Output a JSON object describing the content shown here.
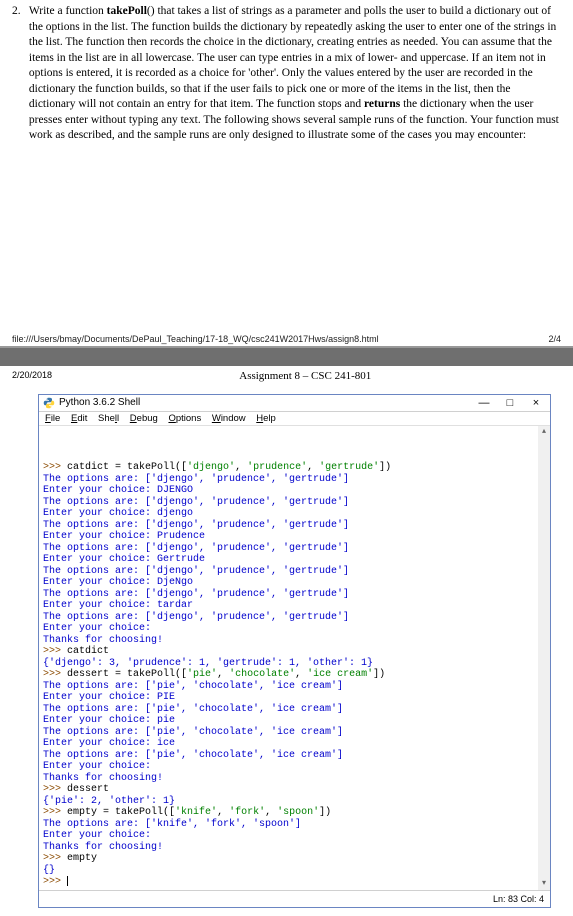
{
  "question": {
    "number": "2.",
    "func": "takePoll",
    "body_parts": [
      "Write a function ",
      "() that takes a list of strings as a parameter and polls the user to build a dictionary out of the options in the list. The function builds the dictionary by repeatedly asking the user to enter one of the strings in the list. The function then records the choice in the dictionary, creating entries as needed. You can assume that the items in the list are in all lowercase. The user can type entries in a mix of lower- and uppercase. If an item not in options is entered, it is recorded as a choice for 'other'. Only the values entered by the user are recorded in the dictionary the function builds, so that if the user fails to pick one or more of the items in the list, then the dictionary will not contain an entry for that item. The function stops and ",
      " the dictionary when the user presses enter without typing any text. The following shows several sample runs of the function. Your function must work as described, and the sample runs are only designed to illustrate some of the cases you may encounter:"
    ],
    "returns": "returns"
  },
  "footer": {
    "path": "file:///Users/bmay/Documents/DePaul_Teaching/17-18_WQ/csc241W2017Hws/assign8.html",
    "page": "2/4"
  },
  "page2": {
    "date": "2/20/2018",
    "title": "Assignment 8 – CSC 241-801"
  },
  "shell": {
    "title": "Python 3.6.2 Shell",
    "menus": [
      "File",
      "Edit",
      "Shell",
      "Debug",
      "Options",
      "Window",
      "Help"
    ],
    "status": "Ln: 83  Col: 4",
    "win_min": "—",
    "win_max": "□",
    "win_close": "×",
    "lines": [
      {
        "cls": "",
        "html": "<span class='prompt'>&gt;&gt;&gt;</span> catdict = takePoll([<span class='str'>'djengo'</span>, <span class='str'>'prudence'</span>, <span class='str'>'gertrude'</span>])"
      },
      {
        "cls": "out",
        "text": "The options are: ['djengo', 'prudence', 'gertrude']"
      },
      {
        "cls": "out",
        "text": "Enter your choice: DJENGO"
      },
      {
        "cls": "out",
        "text": "The options are: ['djengo', 'prudence', 'gertrude']"
      },
      {
        "cls": "out",
        "text": "Enter your choice: djengo"
      },
      {
        "cls": "out",
        "text": "The options are: ['djengo', 'prudence', 'gertrude']"
      },
      {
        "cls": "out",
        "text": "Enter your choice: Prudence"
      },
      {
        "cls": "out",
        "text": "The options are: ['djengo', 'prudence', 'gertrude']"
      },
      {
        "cls": "out",
        "text": "Enter your choice: Gertrude"
      },
      {
        "cls": "out",
        "text": "The options are: ['djengo', 'prudence', 'gertrude']"
      },
      {
        "cls": "out",
        "text": "Enter your choice: DjeNgo"
      },
      {
        "cls": "out",
        "text": "The options are: ['djengo', 'prudence', 'gertrude']"
      },
      {
        "cls": "out",
        "text": "Enter your choice: tardar"
      },
      {
        "cls": "out",
        "text": "The options are: ['djengo', 'prudence', 'gertrude']"
      },
      {
        "cls": "out",
        "text": "Enter your choice: "
      },
      {
        "cls": "out",
        "text": "Thanks for choosing!"
      },
      {
        "cls": "",
        "html": "<span class='prompt'>&gt;&gt;&gt;</span> catdict"
      },
      {
        "cls": "out",
        "text": "{'djengo': 3, 'prudence': 1, 'gertrude': 1, 'other': 1}"
      },
      {
        "cls": "",
        "html": "<span class='prompt'>&gt;&gt;&gt;</span> dessert = takePoll([<span class='str'>'pie'</span>, <span class='str'>'chocolate'</span>, <span class='str'>'ice cream'</span>])"
      },
      {
        "cls": "out",
        "text": "The options are: ['pie', 'chocolate', 'ice cream']"
      },
      {
        "cls": "out",
        "text": "Enter your choice: PIE"
      },
      {
        "cls": "out",
        "text": "The options are: ['pie', 'chocolate', 'ice cream']"
      },
      {
        "cls": "out",
        "text": "Enter your choice: pie"
      },
      {
        "cls": "out",
        "text": "The options are: ['pie', 'chocolate', 'ice cream']"
      },
      {
        "cls": "out",
        "text": "Enter your choice: ice"
      },
      {
        "cls": "out",
        "text": "The options are: ['pie', 'chocolate', 'ice cream']"
      },
      {
        "cls": "out",
        "text": "Enter your choice: "
      },
      {
        "cls": "out",
        "text": "Thanks for choosing!"
      },
      {
        "cls": "",
        "html": "<span class='prompt'>&gt;&gt;&gt;</span> dessert"
      },
      {
        "cls": "out",
        "text": "{'pie': 2, 'other': 1}"
      },
      {
        "cls": "",
        "html": "<span class='prompt'>&gt;&gt;&gt;</span> empty = takePoll([<span class='str'>'knife'</span>, <span class='str'>'fork'</span>, <span class='str'>'spoon'</span>])"
      },
      {
        "cls": "out",
        "text": "The options are: ['knife', 'fork', 'spoon']"
      },
      {
        "cls": "out",
        "text": "Enter your choice: "
      },
      {
        "cls": "out",
        "text": "Thanks for choosing!"
      },
      {
        "cls": "",
        "html": "<span class='prompt'>&gt;&gt;&gt;</span> empty"
      },
      {
        "cls": "out",
        "text": "{}"
      },
      {
        "cls": "",
        "html": "<span class='prompt'>&gt;&gt;&gt;</span> <span class='cursor'></span>"
      }
    ]
  }
}
